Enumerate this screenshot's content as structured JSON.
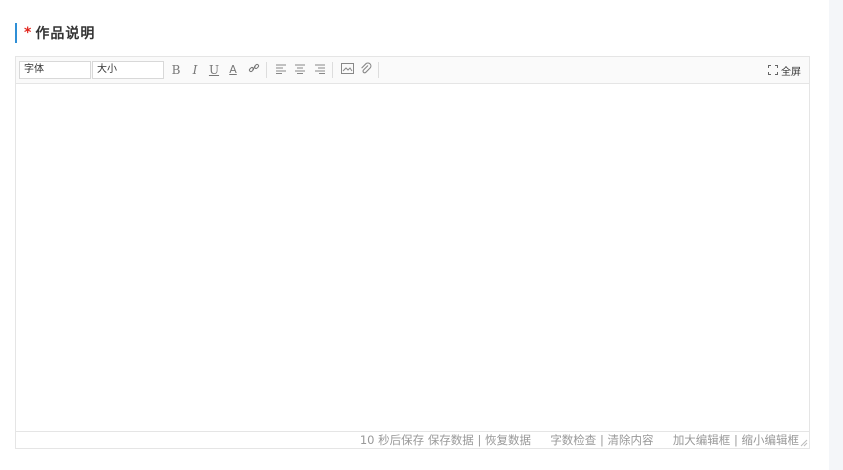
{
  "section": {
    "required_mark": "*",
    "title": "作品说明"
  },
  "toolbar": {
    "font_select": "字体",
    "size_select": "大小",
    "buttons": [
      "B",
      "I",
      "U",
      "A"
    ],
    "fullscreen_label": "全屏"
  },
  "status": {
    "autosave": "10 秒后保存",
    "save": "保存数据",
    "sep1": "|",
    "restore": "恢复数据",
    "wordcheck": "字数检查",
    "sep2": "|",
    "clear": "清除内容",
    "enlarge": "加大编辑框",
    "sep3": "|",
    "shrink": "缩小编辑框"
  },
  "colors": {
    "accent": "#2f8fd6",
    "required": "#e2231a"
  }
}
